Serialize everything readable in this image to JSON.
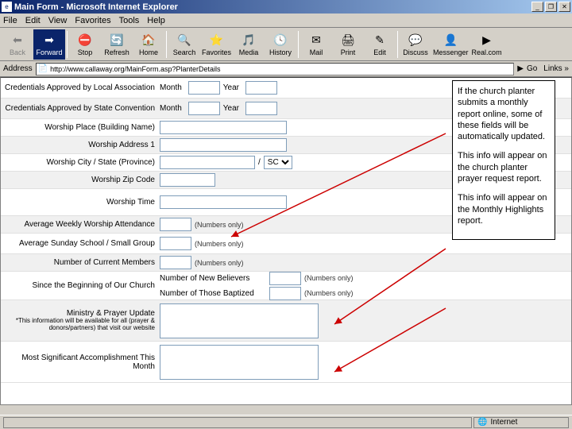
{
  "window": {
    "title": "Main Form - Microsoft Internet Explorer",
    "minimize": "_",
    "maximize": "❐",
    "close": "✕"
  },
  "menubar": [
    "File",
    "Edit",
    "View",
    "Favorites",
    "Tools",
    "Help"
  ],
  "toolbar": {
    "back": "Back",
    "forward": "Forward",
    "stop": "Stop",
    "refresh": "Refresh",
    "home": "Home",
    "search": "Search",
    "favorites": "Favorites",
    "media": "Media",
    "history": "History",
    "mail": "Mail",
    "print": "Print",
    "edit": "Edit",
    "discuss": "Discuss",
    "messenger": "Messenger",
    "real": "Real.com"
  },
  "addressbar": {
    "label": "Address",
    "url": "http://www.callaway.org/MainForm.asp?PlanterDetails",
    "go": "Go",
    "links": "Links"
  },
  "form": {
    "cred_local": "Credentials Approved by Local Association",
    "cred_state": "Credentials Approved by State Convention",
    "month": "Month",
    "year": "Year",
    "worship_place": "Worship Place (Building Name)",
    "worship_addr": "Worship Address 1",
    "worship_city": "Worship City / State (Province)",
    "worship_zip": "Worship Zip Code",
    "worship_time": "Worship Time",
    "avg_weekly": "Average Weekly Worship Attendance",
    "avg_sunday": "Average Sunday School / Small Group",
    "num_members": "Number of Current Members",
    "since_beginning": "Since the Beginning of Our Church",
    "new_believers": "Number of New Believers",
    "baptized": "Number of Those Baptized",
    "numbers_only": "(Numbers only)",
    "ministry_update": "Ministry & Prayer Update",
    "ministry_note": "*This information will be available for all (prayer & donors/partners) that visit our website",
    "most_sig": "Most Significant Accomplishment This Month",
    "state_sel": "SC"
  },
  "callout": {
    "p1": "If the church planter submits a monthly report online, some of these fields will be automatically updated.",
    "p2": "This info will appear on the church planter prayer request report.",
    "p3": "This info will appear on the Monthly Highlights report."
  },
  "statusbar": {
    "done": "",
    "zone": "Internet"
  }
}
